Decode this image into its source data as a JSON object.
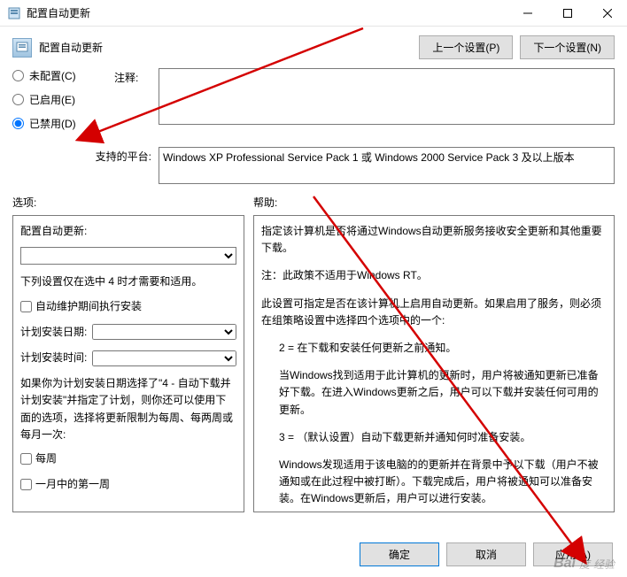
{
  "titlebar": {
    "title": "配置自动更新"
  },
  "header": {
    "title": "配置自动更新",
    "prev_btn": "上一个设置(P)",
    "next_btn": "下一个设置(N)"
  },
  "radios": {
    "not_configured": "未配置(C)",
    "enabled": "已启用(E)",
    "disabled": "已禁用(D)",
    "selected": "disabled"
  },
  "comment": {
    "label": "注释:",
    "value": ""
  },
  "platform": {
    "label": "支持的平台:",
    "value": "Windows XP Professional Service Pack 1 或 Windows 2000 Service Pack 3 及以上版本"
  },
  "section_labels": {
    "options": "选项:",
    "help": "帮助:"
  },
  "options": {
    "title": "配置自动更新:",
    "select_value": "",
    "note": "下列设置仅在选中 4 时才需要和适用。",
    "chk_maint": "自动维护期间执行安装",
    "day_label": "计划安装日期:",
    "time_label": "计划安装时间:",
    "para": "如果你为计划安装日期选择了\"4 - 自动下载并计划安装\"并指定了计划，则你还可以使用下面的选项，选择将更新限制为每周、每两周或每月一次:",
    "chk_weekly": "每周",
    "chk_first_week": "一月中的第一周"
  },
  "help": {
    "p1": "指定该计算机是否将通过Windows自动更新服务接收安全更新和其他重要下载。",
    "p2": "注：此政策不适用于Windows RT。",
    "p3": "此设置可指定是否在该计算机上启用自动更新。如果启用了服务，则必须在组策略设置中选择四个选项中的一个:",
    "p4": "2 = 在下载和安装任何更新之前通知。",
    "p5": "当Windows找到适用于此计算机的更新时，用户将被通知更新已准备好下载。在进入Windows更新之后，用户可以下载并安装任何可用的更新。",
    "p6": "3 = （默认设置）自动下载更新并通知何时准备安装。",
    "p7": "Windows发现适用于该电脑的的更新并在背景中予以下载（用户不被通知或在此过程中被打断）。下载完成后，用户将被通知可以准备安装。在Windows更新后，用户可以进行安装。"
  },
  "footer": {
    "ok": "确定",
    "cancel": "取消",
    "apply": "应用(A)"
  },
  "watermark": {
    "logo": "Bai",
    "du": "度",
    "text": "经验"
  }
}
